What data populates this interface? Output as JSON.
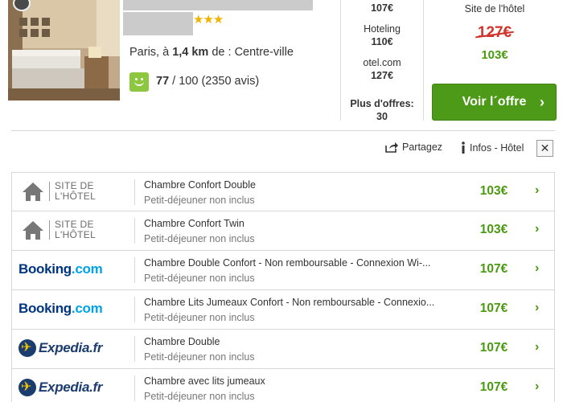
{
  "hotel": {
    "stars": "★★★",
    "location_prefix": "Paris, à ",
    "distance": "1,4 km",
    "location_suffix": " de : Centre-ville",
    "rating_score": "77",
    "rating_rest": " / 100 (2350 avis)"
  },
  "mid_prices": [
    {
      "site": "",
      "price": "107€"
    },
    {
      "site": "Hoteling",
      "price": "110€"
    },
    {
      "site": "otel.com",
      "price": "127€"
    }
  ],
  "more_offers": {
    "label": "Plus d'offres:",
    "count": "30"
  },
  "featured": {
    "site": "Site de l'hôtel",
    "old_price": "127€",
    "price": "103€",
    "button": "Voir l´offre",
    "button_chevron": "›"
  },
  "actions": {
    "share": "Partagez",
    "info": "Infos - Hôtel",
    "close": "✕"
  },
  "offers": [
    {
      "logo": "site-hotel",
      "logo_line1": "SITE DE",
      "logo_line2": "L'HÔTEL",
      "room": "Chambre Confort Double",
      "breakfast": "Petit-déjeuner non inclus",
      "price": "103€",
      "chevron": "›"
    },
    {
      "logo": "site-hotel",
      "logo_line1": "SITE DE",
      "logo_line2": "L'HÔTEL",
      "room": "Chambre Confort Twin",
      "breakfast": "Petit-déjeuner non inclus",
      "price": "103€",
      "chevron": "›"
    },
    {
      "logo": "booking",
      "logo_name": "Booking",
      "logo_dot": ".com",
      "room": "Chambre Double Confort - Non remboursable - Connexion Wi-...",
      "breakfast": "Petit-déjeuner non inclus",
      "price": "107€",
      "chevron": "›"
    },
    {
      "logo": "booking",
      "logo_name": "Booking",
      "logo_dot": ".com",
      "room": "Chambre Lits Jumeaux Confort - Non remboursable - Connexio...",
      "breakfast": "Petit-déjeuner non inclus",
      "price": "107€",
      "chevron": "›"
    },
    {
      "logo": "expedia",
      "logo_name": "Expedia.fr",
      "room": "Chambre Double",
      "breakfast": "Petit-déjeuner non inclus",
      "price": "107€",
      "chevron": "›"
    },
    {
      "logo": "expedia",
      "logo_name": "Expedia.fr",
      "room": "Chambre avec lits jumeaux",
      "breakfast": "Petit-déjeuner non inclus",
      "price": "107€",
      "chevron": "›"
    }
  ],
  "colors": {
    "green_price": "#4a9a10",
    "button_green": "#4c9a17",
    "strike_red": "#d0342c",
    "booking_blue": "#003580",
    "expedia_navy": "#1b3c6e"
  }
}
